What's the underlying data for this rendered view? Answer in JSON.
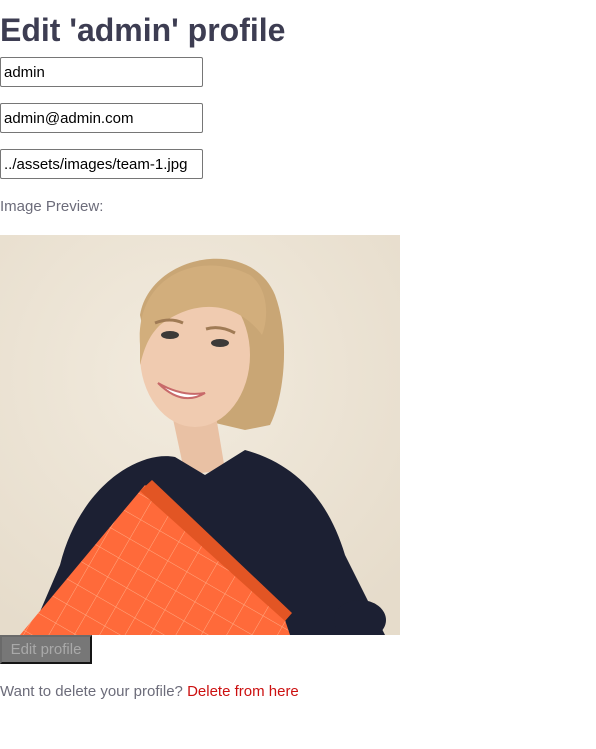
{
  "page": {
    "title": "Edit 'admin' profile"
  },
  "form": {
    "username_value": "admin",
    "email_value": "admin@admin.com",
    "image_value": "../assets/images/team-1.jpg",
    "preview_label": "Image Preview:",
    "submit_label": "Edit profile"
  },
  "footer": {
    "prompt": "Want to delete your profile?",
    "delete_link": "Delete from here"
  },
  "colors": {
    "heading": "#3d3d52",
    "muted_text": "#6c6c7a",
    "link": "#cc1010",
    "button_bg": "#777777"
  }
}
